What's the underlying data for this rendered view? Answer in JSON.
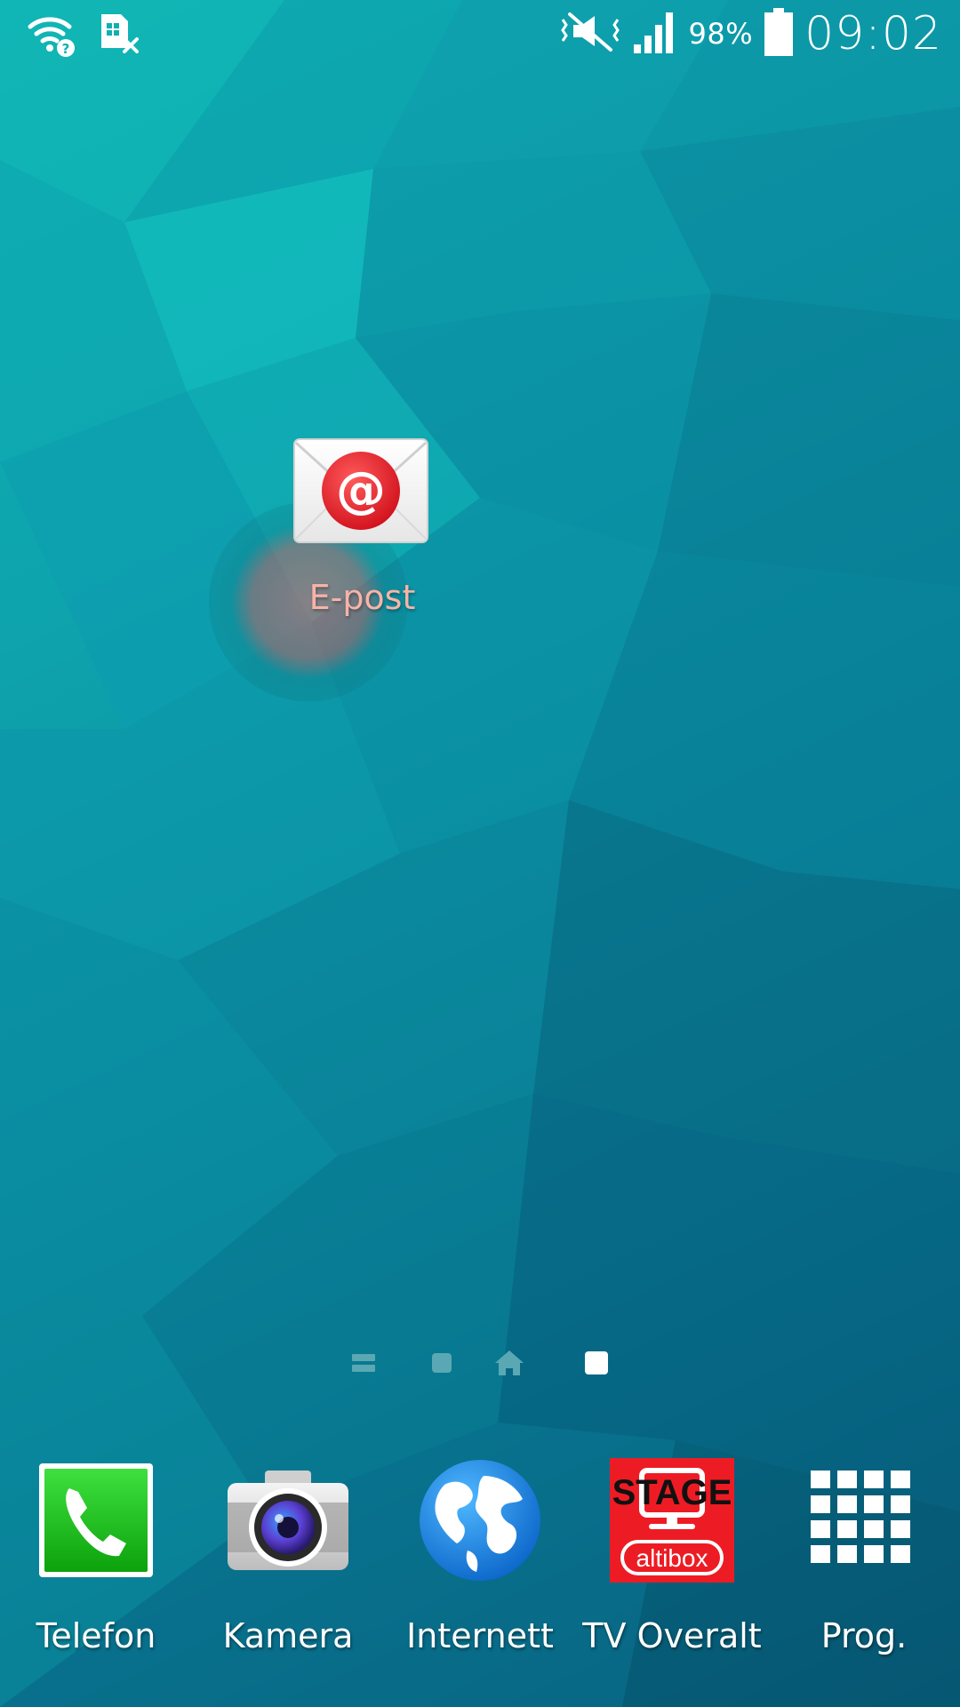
{
  "status_bar": {
    "battery_percent": "98%",
    "clock": "09:02",
    "icons": [
      "wifi-unknown-icon",
      "sim-card-missing-icon",
      "vibrate-mute-icon",
      "signal-icon",
      "battery-icon"
    ]
  },
  "home_screen": {
    "shortcut": {
      "label": "E-post",
      "icon": "email-app-icon",
      "glyph": "@",
      "accent": "#e8202a"
    },
    "page_indicator": {
      "icons": [
        "briefing-page-icon",
        "page-dot-icon",
        "home-page-icon",
        "page-dot-active-icon"
      ],
      "active_index": 3
    }
  },
  "dock": {
    "items": [
      {
        "label": "Telefon",
        "icon": "phone-app-icon",
        "color": "#1ec81e"
      },
      {
        "label": "Kamera",
        "icon": "camera-app-icon",
        "color": "#5b3fd1"
      },
      {
        "label": "Internett",
        "icon": "internet-globe-icon",
        "color": "#1a8ce0"
      },
      {
        "label": "TV Overalt",
        "icon": "altibox-stage-icon",
        "color": "#ed1c24",
        "logo_top": "STAGE",
        "logo_bottom": "altibox"
      },
      {
        "label": "Prog.",
        "icon": "apps-grid-icon",
        "color": "#ffffff"
      }
    ]
  }
}
